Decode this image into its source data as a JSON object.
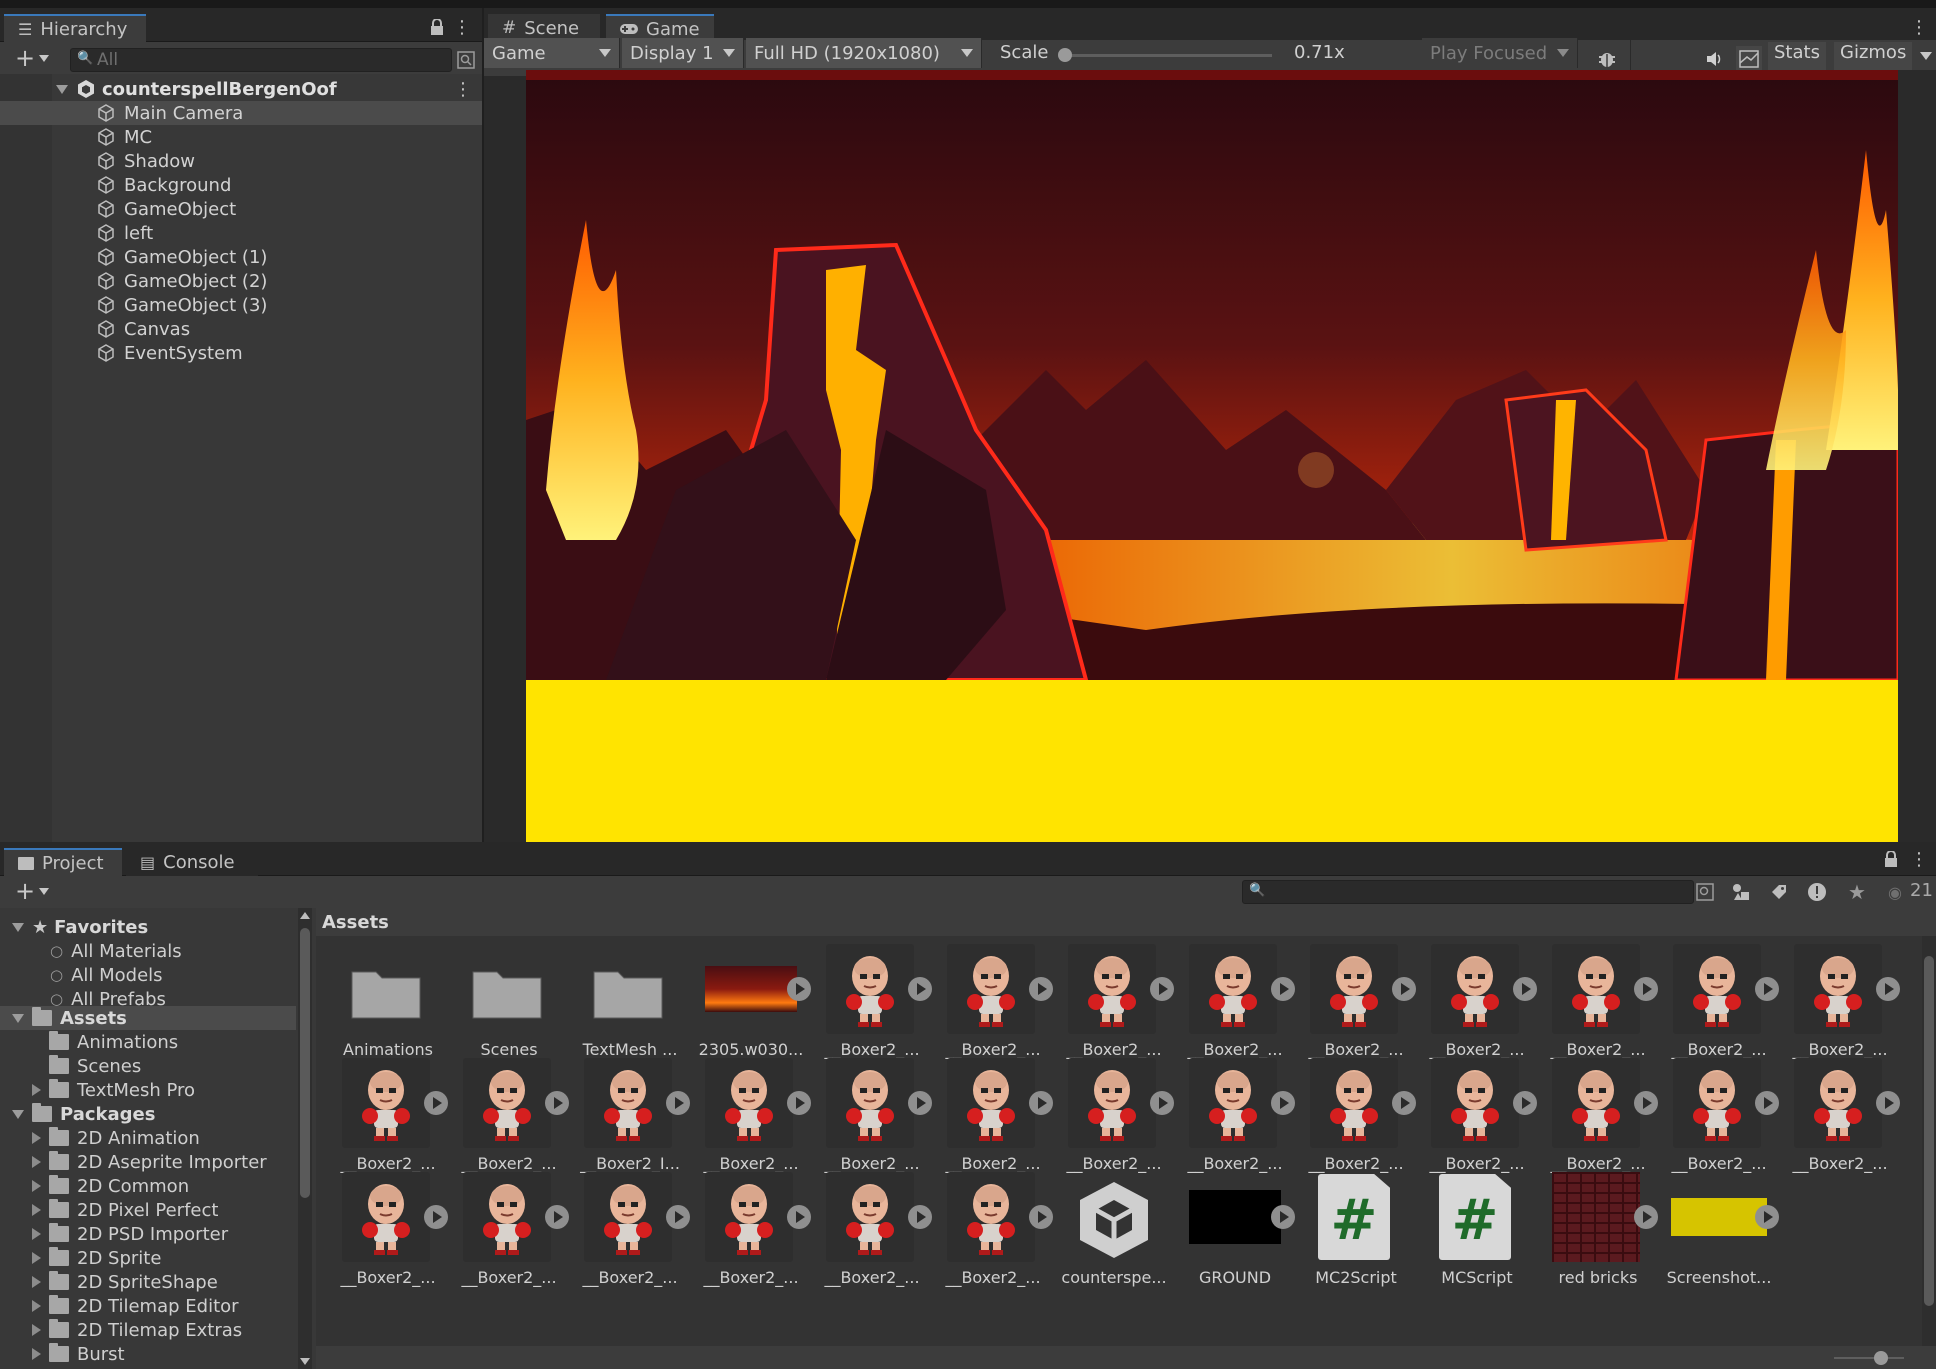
{
  "hierarchy": {
    "tab_label": "Hierarchy",
    "search_placeholder": "All",
    "scene_name": "counterspellBergenOof",
    "items": [
      "Main Camera",
      "MC",
      "Shadow",
      "Background",
      "GameObject",
      "left",
      "GameObject (1)",
      "GameObject (2)",
      "GameObject (3)",
      "Canvas",
      "EventSystem"
    ],
    "selected_index": 0
  },
  "game_view": {
    "tabs": [
      {
        "label": "Scene",
        "icon": "hash-icon"
      },
      {
        "label": "Game",
        "icon": "gamepad-icon"
      }
    ],
    "active_tab": "Game",
    "view_mode": "Game",
    "display": "Display 1",
    "resolution": "Full HD (1920x1080)",
    "scale_label": "Scale",
    "scale_value": "0.71x",
    "play_mode": "Play Focused",
    "stats_label": "Stats",
    "gizmos_label": "Gizmos",
    "ground_color": "#ffe400"
  },
  "project": {
    "tabs": [
      {
        "label": "Project",
        "icon": "folder-icon"
      },
      {
        "label": "Console",
        "icon": "console-icon"
      }
    ],
    "visible_count": "21",
    "breadcrumb": "Assets",
    "favorites": {
      "label": "Favorites",
      "items": [
        "All Materials",
        "All Models",
        "All Prefabs"
      ]
    },
    "assets": {
      "label": "Assets",
      "items": [
        "Animations",
        "Scenes",
        "TextMesh Pro"
      ]
    },
    "packages": {
      "label": "Packages",
      "items": [
        "2D Animation",
        "2D Aseprite Importer",
        "2D Common",
        "2D Pixel Perfect",
        "2D PSD Importer",
        "2D Sprite",
        "2D SpriteShape",
        "2D Tilemap Editor",
        "2D Tilemap Extras",
        "Burst"
      ]
    },
    "grid_rows": [
      [
        {
          "label": "Animations",
          "kind": "folder"
        },
        {
          "label": "Scenes",
          "kind": "folder"
        },
        {
          "label": "TextMesh ...",
          "kind": "folder"
        },
        {
          "label": "2305.w030...",
          "kind": "image"
        },
        {
          "label": "__Boxer2_...",
          "kind": "sprite"
        },
        {
          "label": "__Boxer2_...",
          "kind": "sprite"
        },
        {
          "label": "__Boxer2_...",
          "kind": "sprite"
        },
        {
          "label": "__Boxer2_...",
          "kind": "sprite"
        },
        {
          "label": "__Boxer2_...",
          "kind": "sprite"
        },
        {
          "label": "__Boxer2_...",
          "kind": "sprite"
        },
        {
          "label": "__Boxer2_...",
          "kind": "sprite"
        },
        {
          "label": "__Boxer2_...",
          "kind": "sprite"
        },
        {
          "label": "__Boxer2_...",
          "kind": "sprite"
        }
      ],
      [
        {
          "label": "__Boxer2_...",
          "kind": "sprite"
        },
        {
          "label": "__Boxer2_...",
          "kind": "sprite"
        },
        {
          "label": "__Boxer2_I...",
          "kind": "sprite"
        },
        {
          "label": "__Boxer2_...",
          "kind": "sprite"
        },
        {
          "label": "__Boxer2_...",
          "kind": "sprite"
        },
        {
          "label": "__Boxer2_...",
          "kind": "sprite"
        },
        {
          "label": "__Boxer2_...",
          "kind": "sprite"
        },
        {
          "label": "__Boxer2_...",
          "kind": "sprite"
        },
        {
          "label": "__Boxer2_...",
          "kind": "sprite"
        },
        {
          "label": "__Boxer2_...",
          "kind": "sprite"
        },
        {
          "label": "__Boxer2_...",
          "kind": "sprite"
        },
        {
          "label": "__Boxer2_...",
          "kind": "sprite"
        },
        {
          "label": "__Boxer2_...",
          "kind": "sprite"
        }
      ],
      [
        {
          "label": "__Boxer2_...",
          "kind": "sprite"
        },
        {
          "label": "__Boxer2_...",
          "kind": "sprite"
        },
        {
          "label": "__Boxer2_...",
          "kind": "sprite"
        },
        {
          "label": "__Boxer2_...",
          "kind": "sprite"
        },
        {
          "label": "__Boxer2_...",
          "kind": "sprite"
        },
        {
          "label": "__Boxer2_...",
          "kind": "sprite"
        },
        {
          "label": "counterspe...",
          "kind": "unity-scene"
        },
        {
          "label": "GROUND",
          "kind": "black-sprite"
        },
        {
          "label": "MC2Script",
          "kind": "script"
        },
        {
          "label": "MCScript",
          "kind": "script"
        },
        {
          "label": "red bricks",
          "kind": "bricks"
        },
        {
          "label": "Screenshot...",
          "kind": "yellow-sprite"
        }
      ]
    ]
  }
}
